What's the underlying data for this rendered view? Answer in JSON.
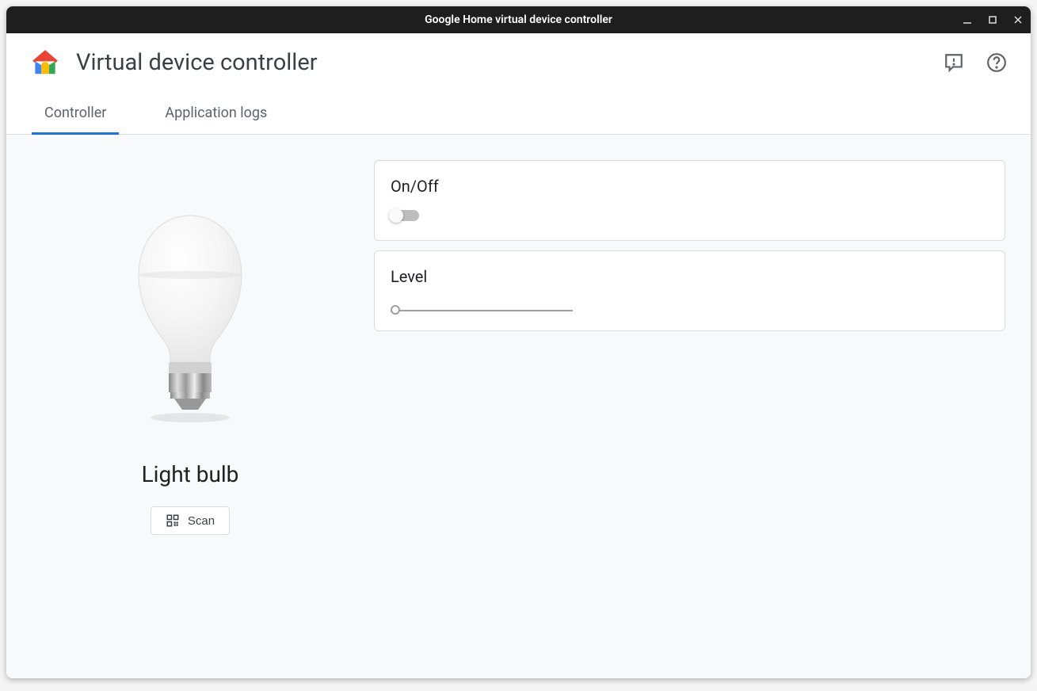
{
  "window": {
    "title": "Google Home virtual device controller"
  },
  "header": {
    "title": "Virtual device controller"
  },
  "tabs": [
    {
      "label": "Controller",
      "active": true
    },
    {
      "label": "Application logs",
      "active": false
    }
  ],
  "device": {
    "name": "Light bulb",
    "scan_label": "Scan"
  },
  "controls": {
    "onoff": {
      "title": "On/Off",
      "value": false
    },
    "level": {
      "title": "Level",
      "value": 0
    }
  }
}
